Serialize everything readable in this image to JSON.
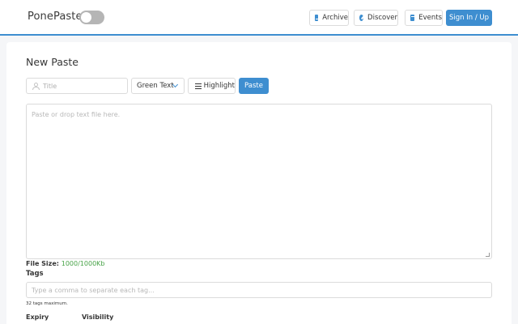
{
  "header": {
    "brand": "PonePaste",
    "dark_mode_toggle": "off",
    "nav": [
      {
        "label": "Archive",
        "icon": "book-icon"
      },
      {
        "label": "Discover",
        "icon": "compass-icon"
      },
      {
        "label": "Events",
        "icon": "calendar-icon"
      }
    ],
    "signin_label": "Sign In / Up"
  },
  "main": {
    "title": "New Paste",
    "title_placeholder": "Title",
    "format_selected": "Green Text",
    "highlight_label": "Highlight",
    "paste_label": "Paste",
    "content_placeholder": "Paste or drop text file here.",
    "file_size_label": "File Size:",
    "file_size_value": "1000/1000Kb",
    "tags_label": "Tags",
    "tags_placeholder": "Type a comma to separate each tag...",
    "tags_help": "32 tags maximum.",
    "expiry_label": "Expiry",
    "visibility_label": "Visibility"
  },
  "colors": {
    "accent": "#3e8ed0",
    "file_size_ok": "#48a348"
  }
}
